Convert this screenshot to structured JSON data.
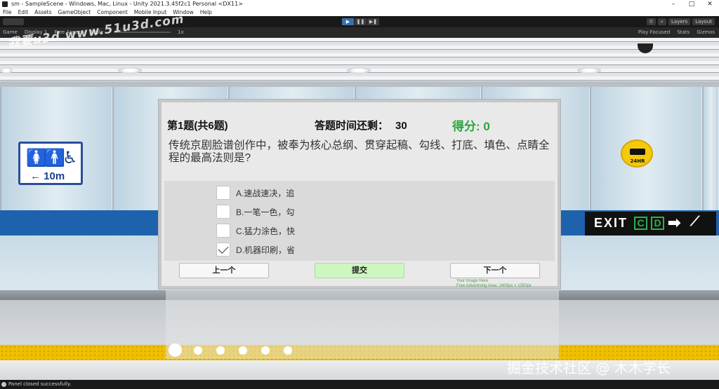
{
  "window": {
    "title": "sm - SampleScene - Windows, Mac, Linux - Unity 2021.3.45f2c1 Personal <DX11>",
    "controls": [
      "–",
      "□",
      "✕"
    ]
  },
  "menu": [
    "File",
    "Edit",
    "Assets",
    "GameObject",
    "Component",
    "Mobile Input",
    "Window",
    "Help"
  ],
  "toolbar": {
    "right_buttons": [
      "⏲",
      "⌕",
      "Layers",
      "Layout"
    ]
  },
  "game_bar": {
    "tab": "Game",
    "display": "Display 1",
    "aspect": "Free Aspect",
    "scale_label": "Scale",
    "scale_value": "1x",
    "play_mode": "Play Focused",
    "stats": "Stats",
    "gizmos": "Gizmos"
  },
  "scene": {
    "sign_wc_distance": "← 10m",
    "sign_24hr": "24HR",
    "exit_word": "EXIT",
    "exit_c": "C",
    "exit_d": "D"
  },
  "quiz": {
    "question_number": "第1题(共6题)",
    "timer_label": "答题时间还剩：",
    "timer_value": "30",
    "score_text": "得分: 0",
    "question_text": "传统京剧脸谱创作中，被奉为核心总纲、贯穿起稿、勾线、打底、填色、点睛全程的最高法则是?",
    "options": [
      {
        "label": "A.速战速决，追",
        "checked": false
      },
      {
        "label": "B.一笔一色，勾",
        "checked": false
      },
      {
        "label": "C.猛力涂色，快",
        "checked": false
      },
      {
        "label": "D.机器印刷，省",
        "checked": true
      }
    ],
    "buttons": {
      "prev": "上一个",
      "submit": "提交",
      "next": "下一个"
    },
    "ad_line1": "Your Image Here",
    "ad_line2": "Free Advertising Area: 2400px × 1350px",
    "progress_total": 6,
    "progress_current": 1
  },
  "watermarks": {
    "top_left": "我要u3d  www.51u3d.com",
    "bottom_right": "掘金技术社区 @ 木木学长"
  },
  "status": {
    "message": "Panel closed successfully."
  }
}
